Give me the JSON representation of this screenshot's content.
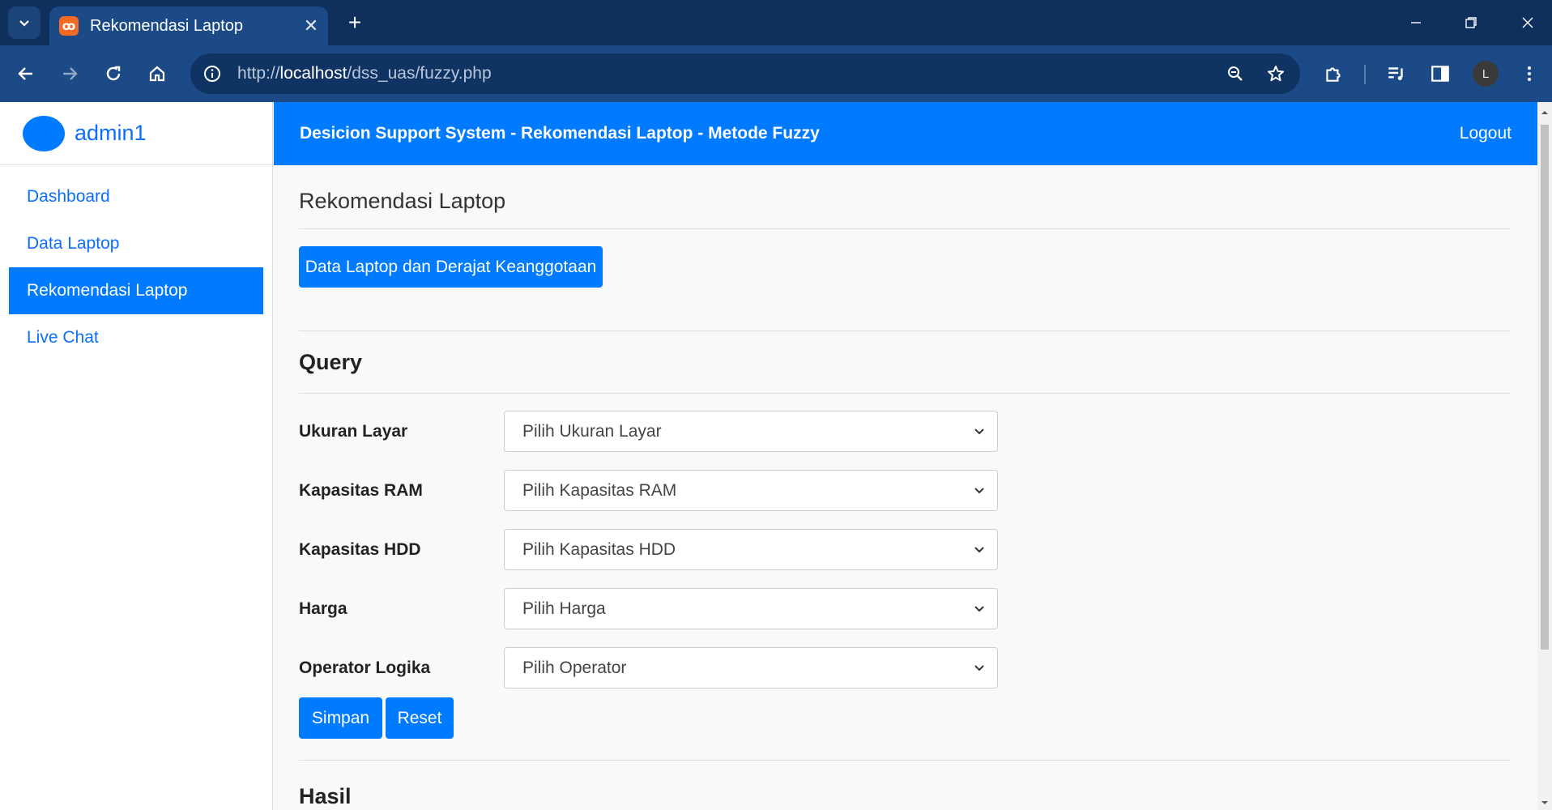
{
  "browser": {
    "tab_title": "Rekomendasi Laptop",
    "url_prefix": "http://",
    "url_host": "localhost",
    "url_path": "/dss_uas/fuzzy.php",
    "profile_initial": "L"
  },
  "sidebar": {
    "username": "admin1",
    "items": [
      {
        "label": "Dashboard"
      },
      {
        "label": "Data Laptop"
      },
      {
        "label": "Rekomendasi Laptop"
      },
      {
        "label": "Live Chat"
      }
    ]
  },
  "topbar": {
    "brand": "Desicion Support System - Rekomendasi Laptop - Metode Fuzzy",
    "logout": "Logout"
  },
  "main": {
    "heading": "Rekomendasi Laptop",
    "data_button": "Data Laptop dan Derajat Keanggotaan",
    "query_title": "Query",
    "fields": [
      {
        "label": "Ukuran Layar",
        "value": "Pilih Ukuran Layar"
      },
      {
        "label": "Kapasitas RAM",
        "value": "Pilih Kapasitas RAM"
      },
      {
        "label": "Kapasitas HDD",
        "value": "Pilih Kapasitas HDD"
      },
      {
        "label": "Harga",
        "value": "Pilih Harga"
      },
      {
        "label": "Operator Logika",
        "value": "Pilih Operator"
      }
    ],
    "save_button": "Simpan",
    "reset_button": "Reset",
    "result_title": "Hasil"
  },
  "colors": {
    "primary": "#007bff",
    "chrome_dark": "#0f2f5c",
    "chrome_toolbar": "#1b4a86"
  }
}
